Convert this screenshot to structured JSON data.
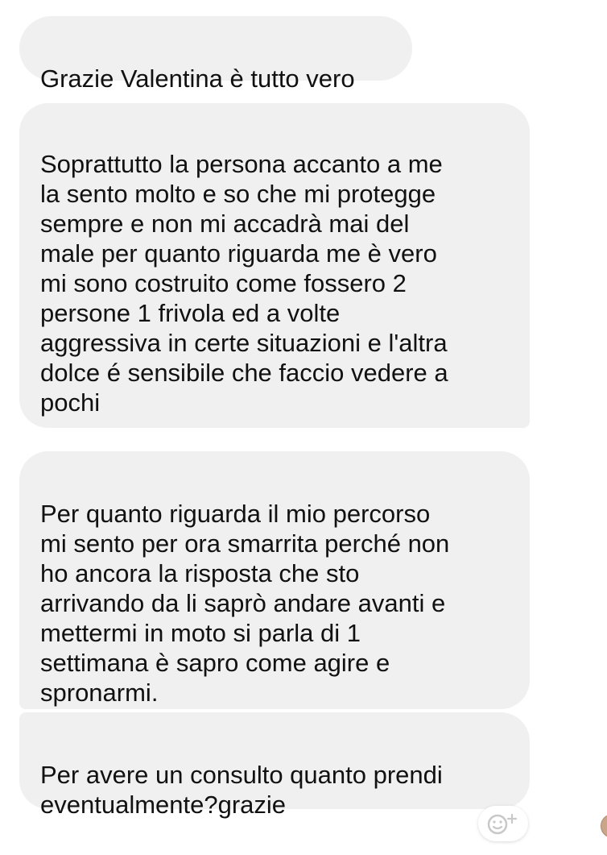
{
  "messages": [
    {
      "text": "Grazie Valentina è tutto vero"
    },
    {
      "text": "Soprattutto la persona accanto a me\nla sento molto e so che mi protegge\nsempre e non mi accadrà mai del\nmale per quanto riguarda me è vero\nmi sono costruito come fossero 2\npersone 1 frivola ed a volte\naggressiva in certe situazioni e l'altra\ndolce é sensibile che faccio vedere a\npochi"
    },
    {
      "text": "Per quanto riguarda il mio percorso\nmi sento per ora smarrita perché non\nho ancora la risposta che sto\narrivando da li saprò andare avanti e\nmettermi in moto si parla di 1\nsettimana è sapro come agire e\nspronarmi."
    },
    {
      "text": "Per avere un consulto quanto prendi\neventualmente?grazie"
    }
  ],
  "react_button": {
    "icon": "smiley-plus-icon"
  },
  "colors": {
    "bubble_bg": "#f0f0f0",
    "text": "#111111",
    "icon": "#c8c8c8"
  }
}
